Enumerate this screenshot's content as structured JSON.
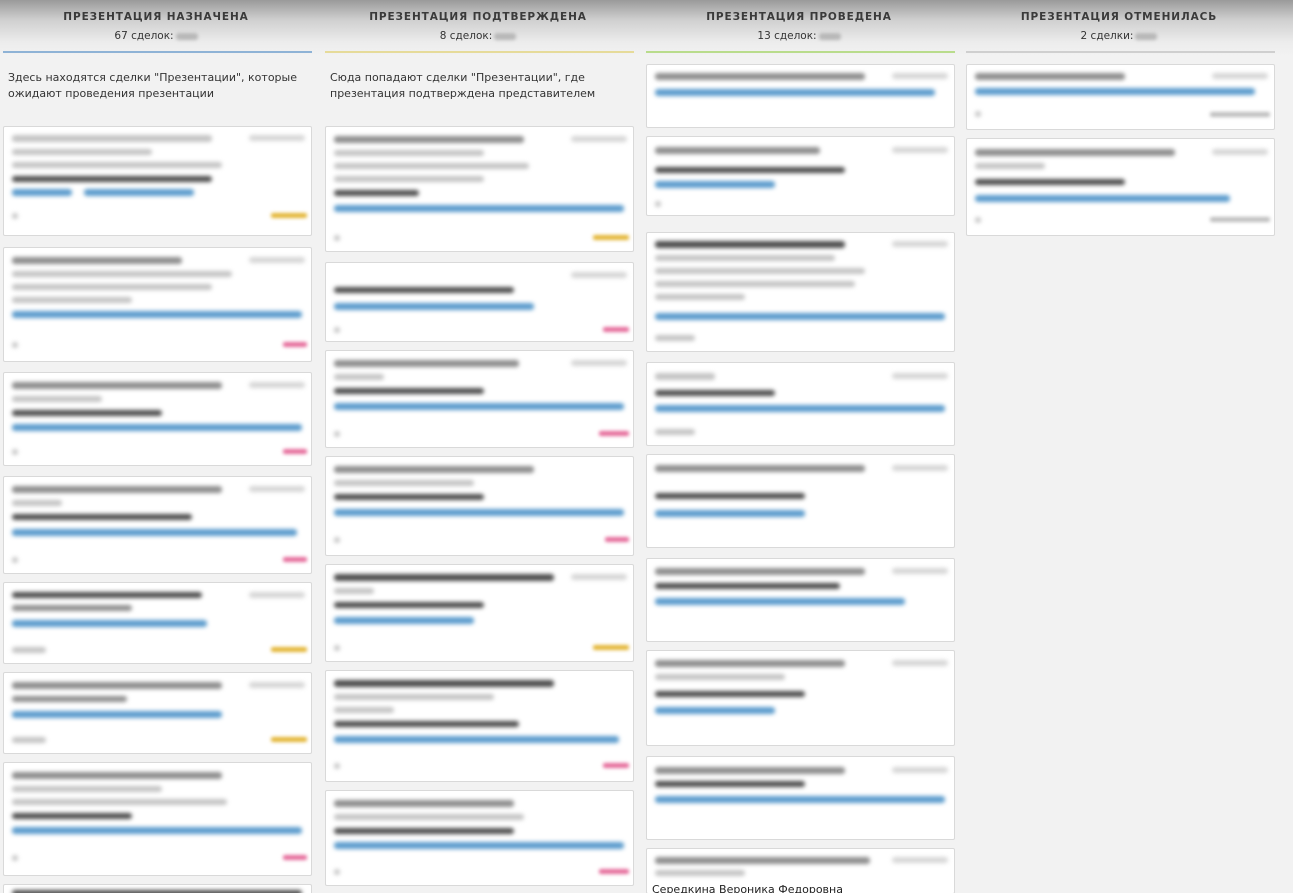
{
  "columns": [
    {
      "title": "ПРЕЗЕНТАЦИЯ НАЗНАЧЕНА",
      "count": "67 сделок:",
      "description": "Здесь находятся сделки \"Презентации\", которые ожидают проведения презентации",
      "accent": "#8fb3d6"
    },
    {
      "title": "ПРЕЗЕНТАЦИЯ ПОДТВЕРЖДЕНА",
      "count": "8 сделок:",
      "description": "Сюда попадают сделки \"Презентации\", где презентация подтверждена представителем",
      "accent": "#e6db9a"
    },
    {
      "title": "ПРЕЗЕНТАЦИЯ ПРОВЕДЕНА",
      "count": "13 сделок:",
      "description": "",
      "accent": "#b9dc8c"
    },
    {
      "title": "ПРЕЗЕНТАЦИЯ ОТМЕНИЛАСЬ",
      "count": "2 сделки:",
      "description": "",
      "accent": "#cfcfcf"
    }
  ],
  "visible_card_text": {
    "last_contact_name": "Середкина Вероника Федоровна"
  },
  "colors": {
    "link_blue": "#5c9ccd",
    "tag_yellow": "#e3b534",
    "tag_pink": "#e56a9a",
    "background": "#f2f2f2"
  }
}
